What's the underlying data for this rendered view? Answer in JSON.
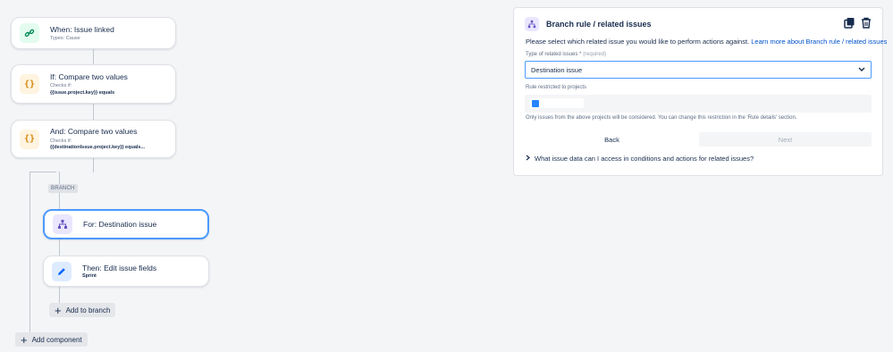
{
  "rule": {
    "trigger": {
      "title": "When: Issue linked",
      "subtitle": "Types: Cause"
    },
    "condition1": {
      "title": "If: Compare two values",
      "checks": "Checks if:",
      "expression": "{{issue.project.key}} equals"
    },
    "condition2": {
      "title": "And: Compare two values",
      "checks": "Checks if:",
      "expression": "{{destinationIssue.project.key}} equals..."
    },
    "branch_badge": "BRANCH",
    "branch": {
      "title": "For: Destination issue"
    },
    "action": {
      "title": "Then: Edit issue fields",
      "subtitle": "Sprint"
    },
    "add_to_branch": "Add to branch",
    "add_component": "Add component"
  },
  "panel": {
    "title": "Branch rule / related issues",
    "intro": "Please select which related issue you would like to perform actions against.",
    "learn_more": "Learn more about Branch rule / related issues",
    "type_label": "Type of related issues",
    "required_mark": "*",
    "required_text": "(required)",
    "type_value": "Destination issue",
    "projects_label": "Rule restricted to projects",
    "help_text": "Only issues from the above projects will be considered. You can change this restriction in the 'Rule details' section.",
    "back_label": "Back",
    "next_label": "Next",
    "faq": "What issue data can I access in conditions and actions for related issues?"
  },
  "icons": {
    "trigger": "link-icon",
    "condition": "curly-braces-icon",
    "branch": "hierarchy-icon",
    "action": "pencil-icon",
    "duplicate": "duplicate-icon",
    "delete": "trash-icon",
    "dropdown": "chevron-down-icon",
    "expand": "chevron-right-icon"
  },
  "colors": {
    "accent": "#0052cc",
    "selected_border": "#4c9aff",
    "trigger_icon": "#00875a",
    "condition_icon": "#d4860b",
    "branch_icon": "#6554c0",
    "action_icon": "#0065ff"
  }
}
